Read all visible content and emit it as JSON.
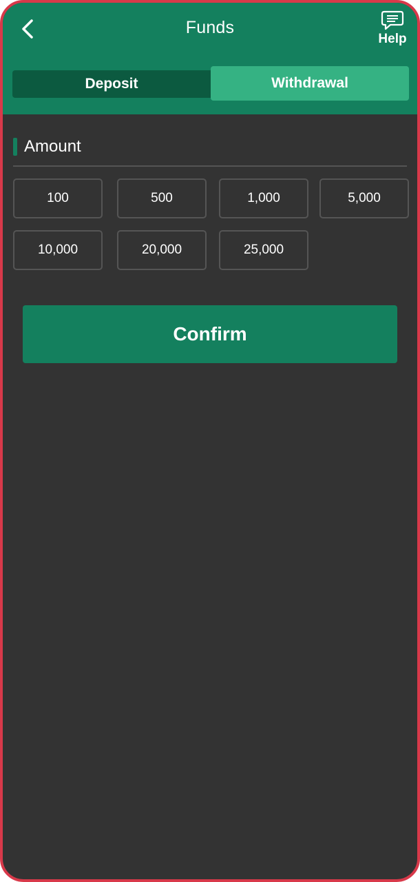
{
  "header": {
    "title": "Funds",
    "help_label": "Help",
    "back_icon": "chevron-left-icon",
    "help_icon": "chat-bubble-icon"
  },
  "tabs": [
    {
      "label": "Deposit",
      "active": false
    },
    {
      "label": "Withdrawal",
      "active": true
    }
  ],
  "amount": {
    "label": "Amount",
    "options": [
      "100",
      "500",
      "1,000",
      "5,000",
      "10,000",
      "20,000",
      "25,000"
    ]
  },
  "confirm": {
    "label": "Confirm"
  },
  "colors": {
    "brand_green": "#14805e",
    "active_tab": "#35b283",
    "inactive_tab": "#0c5a40",
    "background": "#333333",
    "frame_border": "#d8394a"
  }
}
